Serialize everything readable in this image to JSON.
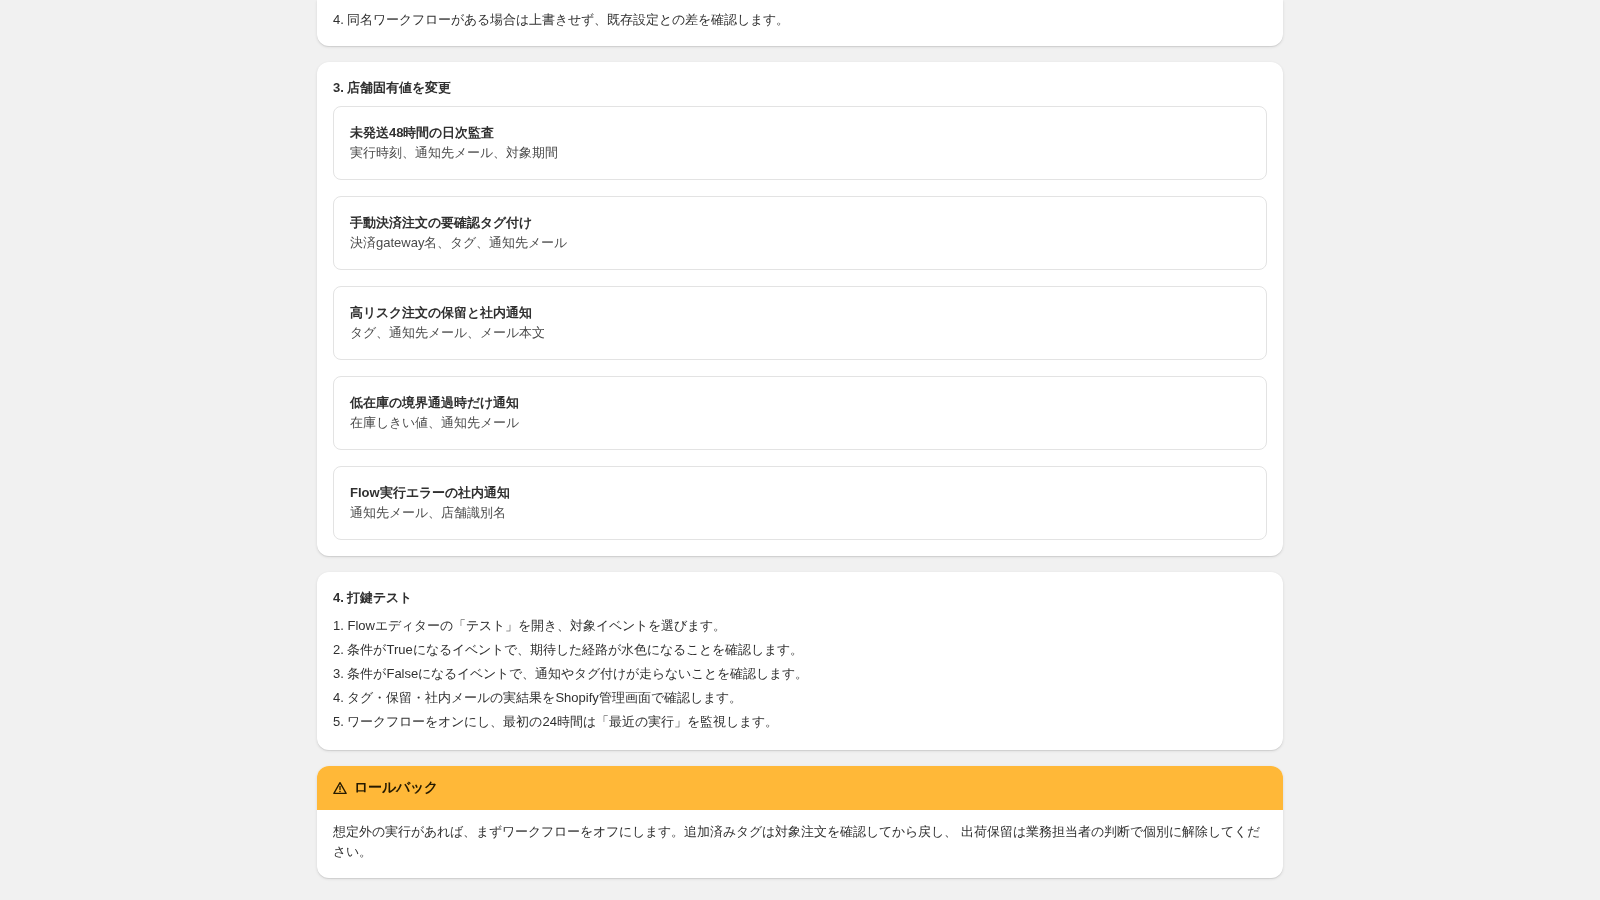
{
  "sections": [
    {
      "kind": "steps",
      "steps": [
        "4. 同名ワークフローがある場合は上書きせず、既存設定との差を確認します。"
      ]
    },
    {
      "kind": "cards",
      "heading": "3. 店舗固有値を変更",
      "cards": [
        {
          "title": "未発送48時間の日次監査",
          "detail": "実行時刻、通知先メール、対象期間"
        },
        {
          "title": "手動決済注文の要確認タグ付け",
          "detail": "決済gateway名、タグ、通知先メール"
        },
        {
          "title": "高リスク注文の保留と社内通知",
          "detail": "タグ、通知先メール、メール本文"
        },
        {
          "title": "低在庫の境界通過時だけ通知",
          "detail": "在庫しきい値、通知先メール"
        },
        {
          "title": "Flow実行エラーの社内通知",
          "detail": "通知先メール、店舗識別名"
        }
      ]
    },
    {
      "kind": "steps",
      "heading": "4. 打鍵テスト",
      "steps": [
        "1. Flowエディターの「テスト」を開き、対象イベントを選びます。",
        "2. 条件がTrueになるイベントで、期待した経路が水色になることを確認します。",
        "3. 条件がFalseになるイベントで、通知やタグ付けが走らないことを確認します。",
        "4. タグ・保留・社内メールの実結果をShopify管理画面で確認します。",
        "5. ワークフローをオンにし、最初の24時間は「最近の実行」を監視します。"
      ]
    },
    {
      "kind": "callout",
      "title": "ロールバック",
      "body": "想定外の実行があれば、まずワークフローをオフにします。追加済みタグは対象注文を確認してから戻し、 出荷保留は業務担当者の判断で個別に解除してください。"
    }
  ]
}
